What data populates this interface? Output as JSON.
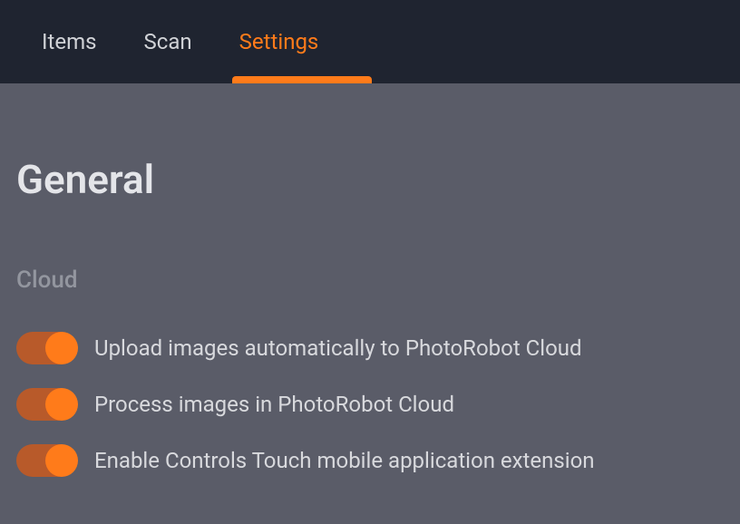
{
  "tabs": {
    "items": "Items",
    "scan": "Scan",
    "settings": "Settings",
    "activeIndex": 2
  },
  "page": {
    "title": "General"
  },
  "section": {
    "label": "Cloud"
  },
  "toggles": {
    "upload": {
      "label": "Upload images automatically to PhotoRobot Cloud",
      "on": true
    },
    "process": {
      "label": "Process images in PhotoRobot Cloud",
      "on": true
    },
    "touch": {
      "label": "Enable Controls Touch mobile application extension",
      "on": true
    }
  },
  "colors": {
    "accent": "#ff7b1a",
    "tabBarBg": "#1f2430",
    "contentBg": "#5a5c68"
  }
}
